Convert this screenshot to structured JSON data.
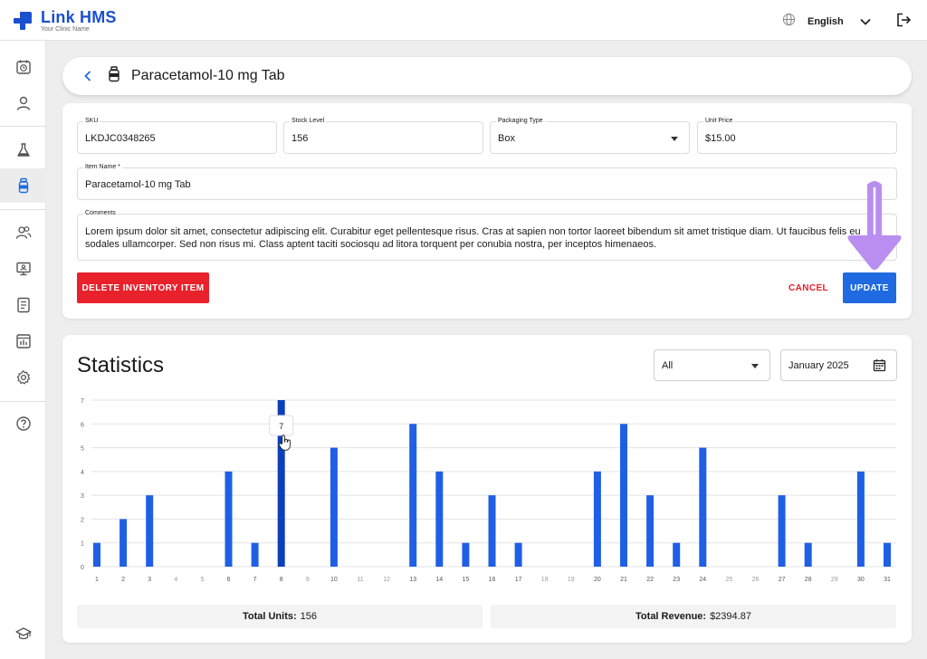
{
  "app": {
    "name": "Link HMS",
    "subtitle": "Your Clinic Name",
    "language": "English",
    "brand_color": "#1a4fcf"
  },
  "sidebar": {
    "items": [
      {
        "icon": "calendar-clock-icon"
      },
      {
        "icon": "person-icon"
      },
      {
        "icon": "flask-icon"
      },
      {
        "icon": "medicine-bottle-icon",
        "active": true
      },
      {
        "icon": "users-icon"
      },
      {
        "icon": "monitor-icon"
      },
      {
        "icon": "report-icon"
      },
      {
        "icon": "chart-board-icon"
      },
      {
        "icon": "gear-icon"
      },
      {
        "icon": "help-icon"
      },
      {
        "icon": "graduation-cap-icon"
      }
    ]
  },
  "header": {
    "title": "Paracetamol-10 mg Tab"
  },
  "form": {
    "sku": {
      "label": "SKU",
      "value": "LKDJC0348265"
    },
    "stock_level": {
      "label": "Stock Level",
      "value": "156"
    },
    "packaging_type": {
      "label": "Packaging Type",
      "value": "Box"
    },
    "unit_price": {
      "label": "Unit Price",
      "value": "$15.00"
    },
    "item_name": {
      "label": "Item Name *",
      "value": "Paracetamol-10 mg Tab"
    },
    "comments": {
      "label": "Comments",
      "value": "Lorem ipsum dolor sit amet, consectetur adipiscing elit. Curabitur eget pellentesque risus. Cras at sapien non tortor laoreet bibendum sit amet tristique diam. Ut faucibus felis eu sodales ullamcorper. Sed non risus mi. Class aptent taciti sociosqu ad litora torquent per conubia nostra, per inceptos himenaeos."
    },
    "delete_label": "DELETE INVENTORY ITEM",
    "cancel_label": "CANCEL",
    "update_label": "UPDATE",
    "danger_color": "#e8212b",
    "primary_color": "#1f6ae0"
  },
  "stats": {
    "title": "Statistics",
    "filter": "All",
    "month": "January 2025",
    "tooltip_value": "7",
    "total_units_label": "Total Units:",
    "total_units_value": "156",
    "total_revenue_label": "Total Revenue:",
    "total_revenue_value": "$2394.87"
  },
  "chart_data": {
    "type": "bar",
    "categories": [
      "1",
      "2",
      "3",
      "4",
      "5",
      "6",
      "7",
      "8",
      "9",
      "10",
      "11",
      "12",
      "13",
      "14",
      "15",
      "16",
      "17",
      "18",
      "19",
      "20",
      "21",
      "22",
      "23",
      "24",
      "25",
      "26",
      "27",
      "28",
      "29",
      "30",
      "31"
    ],
    "values": [
      1,
      2,
      3,
      0,
      0,
      4,
      1,
      7,
      0,
      5,
      0,
      0,
      6,
      4,
      1,
      3,
      1,
      0,
      0,
      4,
      6,
      3,
      1,
      5,
      0,
      0,
      3,
      1,
      0,
      4,
      1
    ],
    "ylim": [
      0,
      7
    ],
    "yticks": [
      "0",
      "1",
      "2",
      "3",
      "4",
      "5",
      "6",
      "7"
    ],
    "highlighted_category": "8",
    "bar_color": "#1f5fe6",
    "highlight_color": "#0d3fb8",
    "grid": true
  }
}
